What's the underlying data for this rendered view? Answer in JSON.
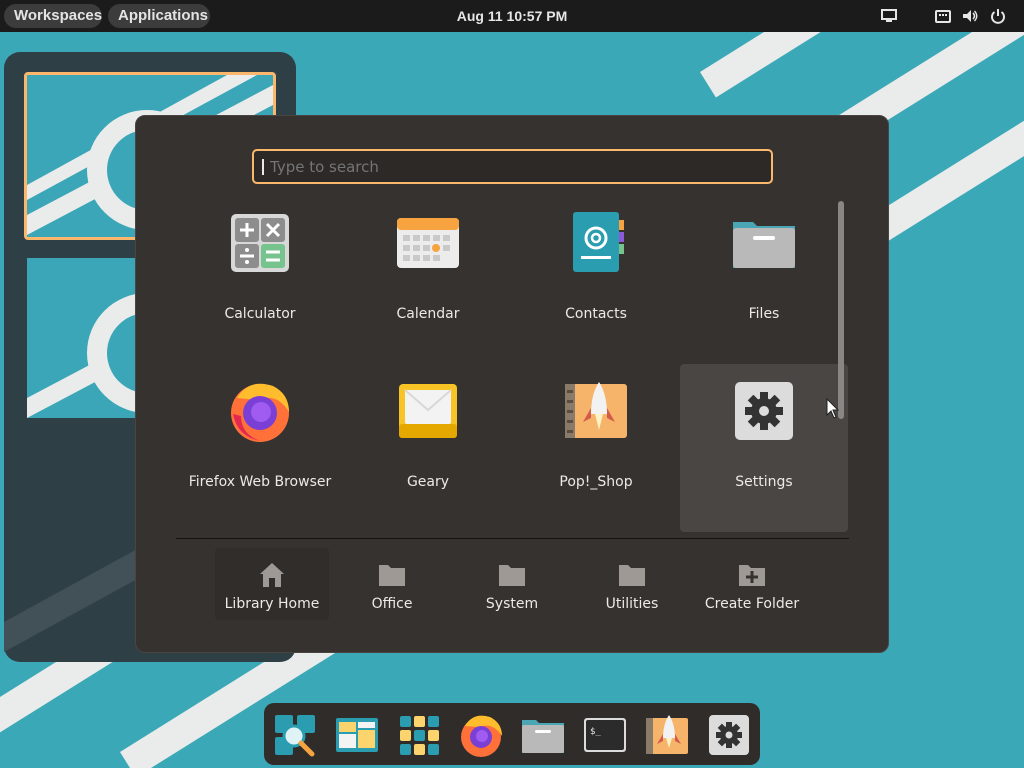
{
  "topbar": {
    "workspaces_label": "Workspaces",
    "applications_label": "Applications",
    "clock": "Aug 11  10:57 PM",
    "tray_icons": [
      "display-icon",
      "keyboard-icon",
      "volume-icon",
      "power-icon"
    ]
  },
  "search": {
    "placeholder": "Type to search",
    "value": ""
  },
  "apps": [
    {
      "label": "Calculator",
      "icon": "calculator-icon"
    },
    {
      "label": "Calendar",
      "icon": "calendar-icon"
    },
    {
      "label": "Contacts",
      "icon": "contacts-icon"
    },
    {
      "label": "Files",
      "icon": "files-icon"
    },
    {
      "label": "Firefox Web Browser",
      "icon": "firefox-icon"
    },
    {
      "label": "Geary",
      "icon": "geary-icon"
    },
    {
      "label": "Pop!_Shop",
      "icon": "pop-shop-icon"
    },
    {
      "label": "Settings",
      "icon": "settings-icon",
      "selected": true
    }
  ],
  "folders": [
    {
      "label": "Library Home",
      "icon": "home-icon",
      "active": true
    },
    {
      "label": "Office",
      "icon": "folder-icon"
    },
    {
      "label": "System",
      "icon": "folder-icon"
    },
    {
      "label": "Utilities",
      "icon": "folder-icon"
    },
    {
      "label": "Create Folder",
      "icon": "folder-plus-icon"
    }
  ],
  "dock": [
    "search-launcher-icon",
    "workspaces-icon",
    "applications-grid-icon",
    "firefox-icon",
    "files-icon",
    "terminal-icon",
    "pop-shop-icon",
    "settings-icon"
  ],
  "colors": {
    "accent": "#fbb86c",
    "wallpaper": "#3aa6b7",
    "launcher_bg": "#36322f"
  }
}
